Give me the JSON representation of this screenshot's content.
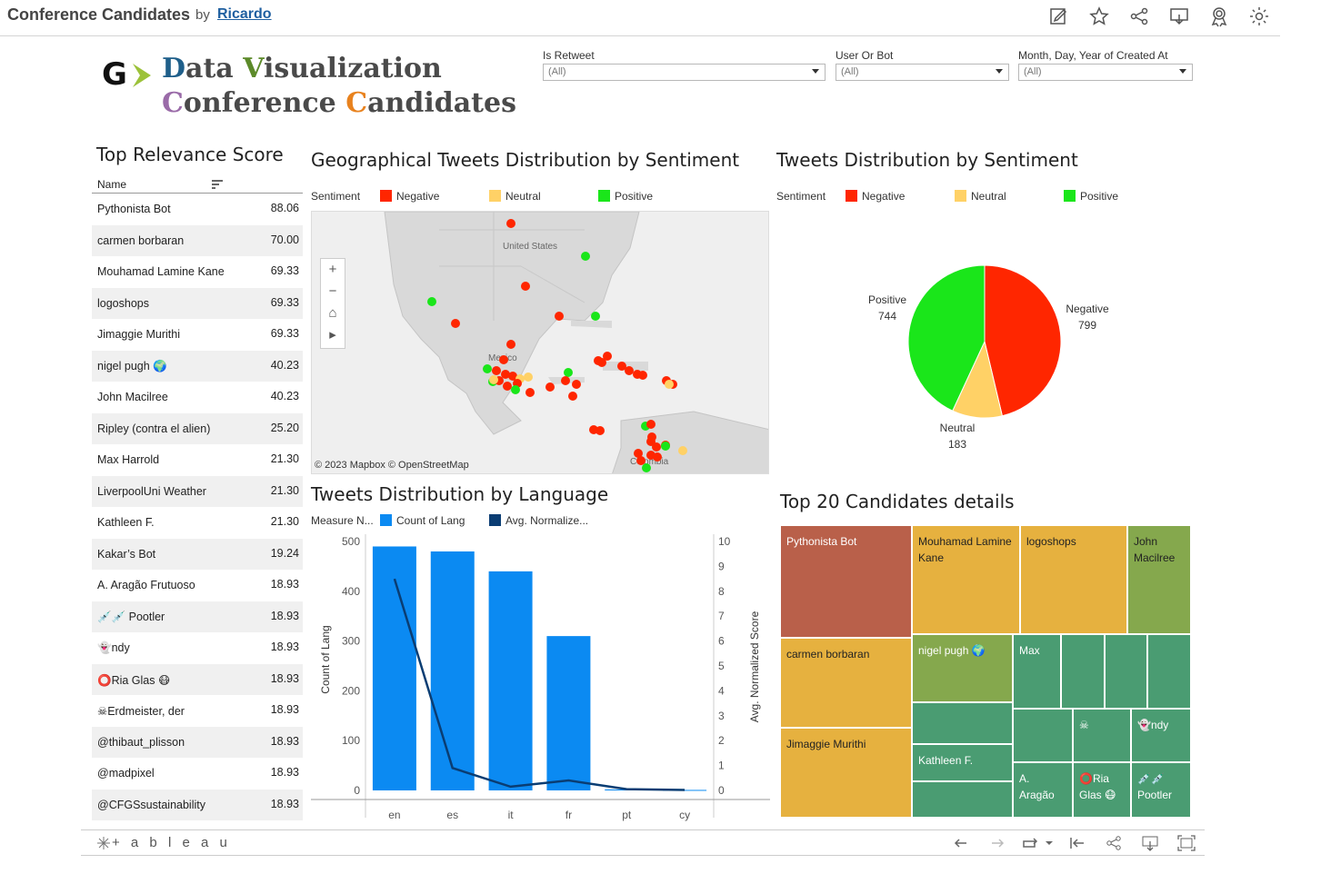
{
  "topbar": {
    "title": "Conference Candidates",
    "by": "by",
    "author": "Ricardo",
    "icons": [
      "edit-icon",
      "star-icon",
      "share-icon",
      "download-icon",
      "badge-icon",
      "gear-icon"
    ]
  },
  "logo": {
    "mark": "G",
    "line1": "Data Visualization",
    "line2": "Conference Candidates",
    "colors": {
      "mark_arrow": "#9cc23a",
      "line1_D": "#1f5f8a",
      "line1_V": "#5c8a2a",
      "line2_C1": "#9a6ba8",
      "line2_C2": "#e8821e"
    }
  },
  "filters": [
    {
      "label": "Is Retweet",
      "value": "(All)"
    },
    {
      "label": "User Or Bot",
      "value": "(All)"
    },
    {
      "label": "Month, Day, Year of Created At",
      "value": "(All)"
    }
  ],
  "relevance": {
    "title": "Top Relevance Score",
    "column": "Name",
    "rows": [
      {
        "name": "Pythonista Bot",
        "score": "88.06"
      },
      {
        "name": "carmen borbaran",
        "score": "70.00"
      },
      {
        "name": "Mouhamad Lamine Kane",
        "score": "69.33"
      },
      {
        "name": "logoshops",
        "score": "69.33"
      },
      {
        "name": "Jimaggie Murithi",
        "score": "69.33"
      },
      {
        "name": "nigel pugh 🌍",
        "score": "40.23"
      },
      {
        "name": "John Macilree",
        "score": "40.23"
      },
      {
        "name": "Ripley (contra el alien)",
        "score": "25.20"
      },
      {
        "name": "Max Harrold",
        "score": "21.30"
      },
      {
        "name": "LiverpoolUni Weather",
        "score": "21.30"
      },
      {
        "name": "Kathleen F.",
        "score": "21.30"
      },
      {
        "name": "Kakar’s Bot",
        "score": "19.24"
      },
      {
        "name": "A. Aragão Frutuoso",
        "score": "18.93"
      },
      {
        "name": "💉💉 Pootler",
        "score": "18.93"
      },
      {
        "name": "👻ndy",
        "score": "18.93"
      },
      {
        "name": "⭕Ria Glas 😷",
        "score": "18.93"
      },
      {
        "name": "☠Erdmeister, der",
        "score": "18.93"
      },
      {
        "name": "@thibaut_plisson",
        "score": "18.93"
      },
      {
        "name": "@madpixel",
        "score": "18.93"
      },
      {
        "name": "@CFGSsustainability",
        "score": "18.93"
      }
    ]
  },
  "colors": {
    "negative": "#ff2600",
    "neutral": "#ffd166",
    "positive": "#1ae61a",
    "count_lang": "#0b8af2",
    "avg_score": "#0a3d73"
  },
  "sentiment_legend": {
    "title": "Sentiment",
    "items": [
      "Negative",
      "Neutral",
      "Positive"
    ]
  },
  "map": {
    "title": "Geographical Tweets Distribution by Sentiment",
    "labels": {
      "country": "United States",
      "country2": "Mexico",
      "country3": "Colombia"
    },
    "attribution": "© 2023 Mapbox  © OpenStreetMap",
    "controls": [
      "+",
      "−",
      "⌂",
      "▸"
    ]
  },
  "pie": {
    "title": "Tweets Distribution by Sentiment",
    "chart_data": {
      "type": "pie",
      "title": "Tweets Distribution by Sentiment",
      "slices": [
        {
          "label": "Negative",
          "value": 799
        },
        {
          "label": "Neutral",
          "value": 183
        },
        {
          "label": "Positive",
          "value": 744
        }
      ]
    }
  },
  "lang": {
    "title": "Tweets Distribution by Language",
    "legend_title": "Measure N...",
    "legend_items": [
      "Count of Lang",
      "Avg. Normalize..."
    ],
    "chart_data": {
      "type": "bar",
      "categories": [
        "en",
        "es",
        "it",
        "fr",
        "pt",
        "cy"
      ],
      "series": [
        {
          "name": "Count of Lang",
          "values": [
            490,
            480,
            440,
            310,
            2,
            1
          ]
        },
        {
          "name": "Avg. Normalized Score",
          "values": [
            8.5,
            0.9,
            0.15,
            0.4,
            0.05,
            0.02
          ]
        }
      ],
      "ylabel": "Count of Lang",
      "y2label": "Avg. Normalized Score",
      "ylim": [
        0,
        500
      ],
      "y2lim": [
        0,
        10
      ],
      "yticks": [
        "0",
        "100",
        "200",
        "300",
        "400",
        "500"
      ],
      "y2ticks": [
        "0",
        "1",
        "2",
        "3",
        "4",
        "5",
        "6",
        "7",
        "8",
        "9",
        "10"
      ]
    }
  },
  "treemap": {
    "title": "Top 20 Candidates details",
    "cells": [
      "Pythonista Bot",
      "Mouhamad Lamine Kane",
      "logoshops",
      "John Macilree",
      "carmen borbaran",
      "nigel pugh 🌍",
      "Max",
      "Jimaggie Murithi",
      "Kathleen F.",
      "☠",
      "👻ndy",
      "A. Aragão",
      "⭕Ria Glas 😷",
      "💉💉 Pootler"
    ]
  },
  "bottombar": {
    "brand": "+ a b l e a u"
  }
}
